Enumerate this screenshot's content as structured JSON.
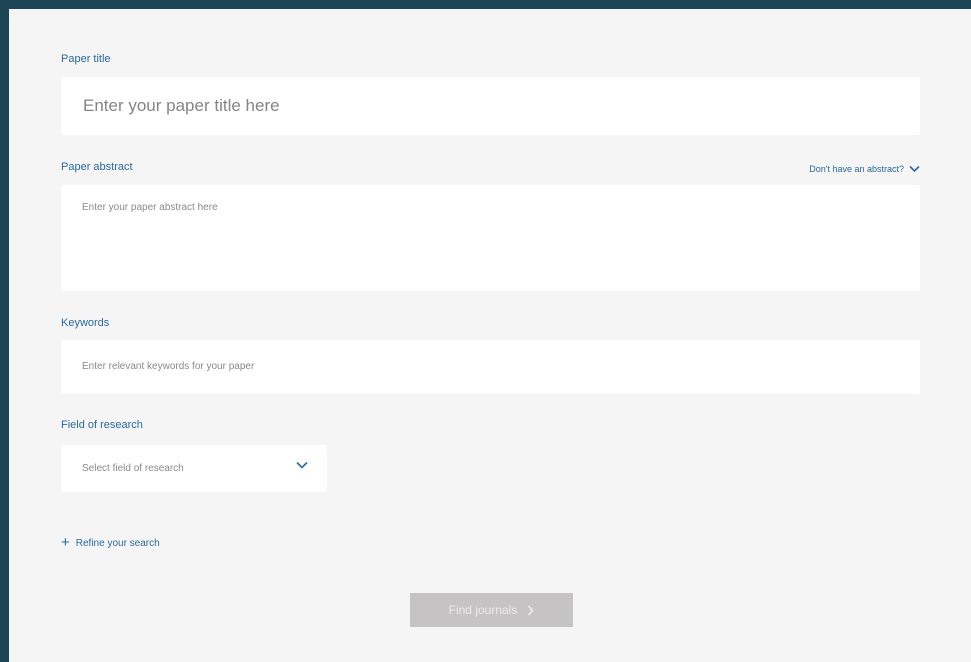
{
  "form": {
    "title": {
      "label": "Paper title",
      "placeholder": "Enter your paper title here"
    },
    "abstract": {
      "label": "Paper abstract",
      "placeholder": "Enter your paper abstract here",
      "toggle_label": "Don't have an abstract?"
    },
    "keywords": {
      "label": "Keywords",
      "placeholder": "Enter relevant keywords for your paper"
    },
    "field_of_research": {
      "label": "Field of research",
      "selected": "Select field of research"
    },
    "refine": {
      "label": "Refine your search"
    },
    "submit": {
      "label": "Find journals"
    }
  },
  "colors": {
    "accent": "#2a6aa0",
    "background_frame": "#1c4656",
    "panel": "#f5f5f5",
    "button_disabled": "#c6c3c4"
  }
}
